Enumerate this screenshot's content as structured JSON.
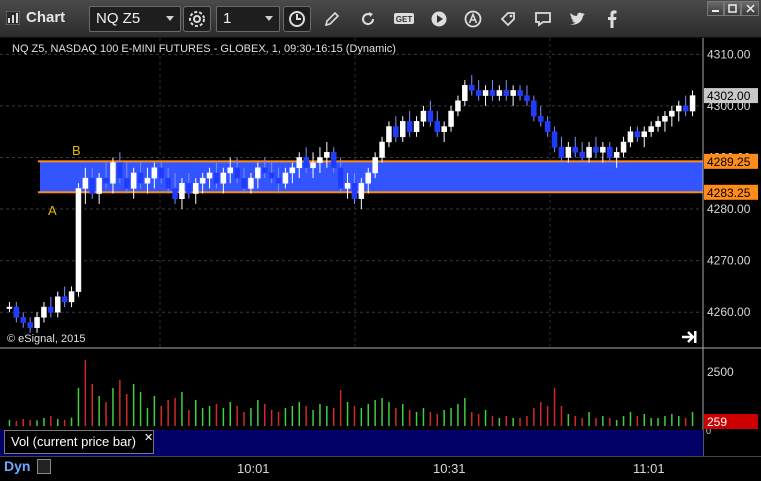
{
  "window": {
    "title": "Chart",
    "symbol": "NQ Z5",
    "interval": "1"
  },
  "toolbar_icons": [
    "settings-gear-icon",
    "clock-icon",
    "pencil-icon",
    "refresh-icon",
    "get-icon",
    "play-icon",
    "alert-a-icon",
    "tag-icon",
    "chat-icon",
    "twitter-icon",
    "facebook-icon"
  ],
  "window_controls": [
    "minimize-icon",
    "maximize-icon",
    "close-icon"
  ],
  "chart": {
    "header": "NQ Z5, NASDAQ 100 E-MINI FUTURES - GLOBEX, 1, 09:30-16:15 (Dynamic)",
    "copyright": "© eSignal, 2015",
    "price_ticks": [
      "4310.00",
      "4300.00",
      "4290.00",
      "4280.00",
      "4270.00",
      "4260.00"
    ],
    "last_price": "4302.00",
    "zone_high": "4289.25",
    "zone_low": "4283.25",
    "label_a": "A",
    "label_b": "B",
    "colors": {
      "up": "#ffffff",
      "down": "#1e3cff",
      "zone": "#3355ff",
      "zone_line": "#ff8c1a",
      "price_tag_bg": "#c8c8c8"
    }
  },
  "volume": {
    "label": "Vol (current price bar)",
    "tick": "2500",
    "zero_tick": "0",
    "current": "259",
    "colors": {
      "up": "#3fcf3f",
      "down": "#cf2a2a",
      "tag_bg": "#cc0000"
    }
  },
  "bottom": {
    "mode": "Dyn",
    "time_labels": [
      "10:01",
      "10:31",
      "11:01"
    ]
  },
  "chart_data": {
    "type": "candlestick",
    "ylim": [
      4255,
      4312
    ],
    "candles": [
      [
        4261,
        4262,
        4260,
        4261
      ],
      [
        4261,
        4262,
        4258,
        4259
      ],
      [
        4259,
        4260,
        4257,
        4258
      ],
      [
        4258,
        4259,
        4256,
        4257
      ],
      [
        4257,
        4260,
        4256,
        4259
      ],
      [
        4259,
        4262,
        4258,
        4261
      ],
      [
        4261,
        4263,
        4259,
        4260
      ],
      [
        4260,
        4264,
        4259,
        4263
      ],
      [
        4263,
        4265,
        4261,
        4262
      ],
      [
        4262,
        4265,
        4261,
        4264
      ],
      [
        4264,
        4285,
        4263,
        4284
      ],
      [
        4284,
        4288,
        4281,
        4286
      ],
      [
        4286,
        4288,
        4282,
        4283
      ],
      [
        4283,
        4287,
        4281,
        4286
      ],
      [
        4286,
        4289,
        4284,
        4285
      ],
      [
        4285,
        4290,
        4283,
        4289
      ],
      [
        4289,
        4291,
        4285,
        4286
      ],
      [
        4286,
        4289,
        4283,
        4284
      ],
      [
        4284,
        4288,
        4282,
        4287
      ],
      [
        4287,
        4289,
        4284,
        4285
      ],
      [
        4285,
        4288,
        4283,
        4286
      ],
      [
        4286,
        4289,
        4284,
        4288
      ],
      [
        4288,
        4289,
        4285,
        4286
      ],
      [
        4286,
        4288,
        4283,
        4284
      ],
      [
        4284,
        4287,
        4281,
        4282
      ],
      [
        4282,
        4286,
        4280,
        4285
      ],
      [
        4285,
        4287,
        4282,
        4283
      ],
      [
        4283,
        4286,
        4281,
        4285
      ],
      [
        4285,
        4287,
        4283,
        4286
      ],
      [
        4286,
        4288,
        4284,
        4287
      ],
      [
        4287,
        4289,
        4284,
        4285
      ],
      [
        4285,
        4288,
        4283,
        4287
      ],
      [
        4287,
        4290,
        4285,
        4288
      ],
      [
        4288,
        4290,
        4285,
        4286
      ],
      [
        4286,
        4288,
        4283,
        4284
      ],
      [
        4284,
        4287,
        4283,
        4286
      ],
      [
        4286,
        4289,
        4284,
        4288
      ],
      [
        4288,
        4290,
        4286,
        4287
      ],
      [
        4287,
        4289,
        4285,
        4286
      ],
      [
        4286,
        4288,
        4283,
        4285
      ],
      [
        4285,
        4288,
        4284,
        4287
      ],
      [
        4287,
        4289,
        4285,
        4288
      ],
      [
        4288,
        4291,
        4286,
        4290
      ],
      [
        4290,
        4292,
        4287,
        4288
      ],
      [
        4288,
        4291,
        4286,
        4289
      ],
      [
        4289,
        4292,
        4287,
        4290
      ],
      [
        4290,
        4293,
        4288,
        4291
      ],
      [
        4291,
        4292,
        4287,
        4288
      ],
      [
        4288,
        4290,
        4283,
        4284
      ],
      [
        4284,
        4287,
        4282,
        4285
      ],
      [
        4285,
        4287,
        4281,
        4282
      ],
      [
        4282,
        4286,
        4280,
        4285
      ],
      [
        4285,
        4288,
        4283,
        4287
      ],
      [
        4287,
        4291,
        4286,
        4290
      ],
      [
        4290,
        4294,
        4289,
        4293
      ],
      [
        4293,
        4297,
        4292,
        4296
      ],
      [
        4296,
        4298,
        4293,
        4294
      ],
      [
        4294,
        4298,
        4293,
        4297
      ],
      [
        4297,
        4299,
        4294,
        4295
      ],
      [
        4295,
        4298,
        4294,
        4297
      ],
      [
        4297,
        4300,
        4296,
        4299
      ],
      [
        4299,
        4301,
        4296,
        4297
      ],
      [
        4297,
        4299,
        4294,
        4295
      ],
      [
        4295,
        4297,
        4293,
        4296
      ],
      [
        4296,
        4300,
        4295,
        4299
      ],
      [
        4299,
        4302,
        4298,
        4301
      ],
      [
        4301,
        4305,
        4300,
        4304
      ],
      [
        4304,
        4306,
        4302,
        4303
      ],
      [
        4303,
        4305,
        4301,
        4302
      ],
      [
        4302,
        4304,
        4300,
        4303
      ],
      [
        4303,
        4305,
        4301,
        4302
      ],
      [
        4302,
        4304,
        4301,
        4303
      ],
      [
        4303,
        4305,
        4301,
        4302
      ],
      [
        4302,
        4304,
        4300,
        4303
      ],
      [
        4303,
        4304,
        4301,
        4302
      ],
      [
        4302,
        4304,
        4300,
        4301
      ],
      [
        4301,
        4302,
        4297,
        4298
      ],
      [
        4298,
        4300,
        4296,
        4297
      ],
      [
        4297,
        4298,
        4294,
        4295
      ],
      [
        4295,
        4296,
        4291,
        4292
      ],
      [
        4292,
        4294,
        4289,
        4290
      ],
      [
        4290,
        4293,
        4289,
        4292
      ],
      [
        4292,
        4294,
        4290,
        4291
      ],
      [
        4291,
        4293,
        4289,
        4290
      ],
      [
        4290,
        4293,
        4289,
        4292
      ],
      [
        4292,
        4294,
        4290,
        4291
      ],
      [
        4291,
        4293,
        4289,
        4292
      ],
      [
        4292,
        4293,
        4289,
        4290
      ],
      [
        4290,
        4292,
        4288,
        4291
      ],
      [
        4291,
        4294,
        4290,
        4293
      ],
      [
        4293,
        4296,
        4292,
        4295
      ],
      [
        4295,
        4296,
        4293,
        4294
      ],
      [
        4294,
        4296,
        4292,
        4295
      ],
      [
        4295,
        4297,
        4294,
        4296
      ],
      [
        4296,
        4298,
        4295,
        4297
      ],
      [
        4297,
        4299,
        4295,
        4298
      ],
      [
        4298,
        4300,
        4296,
        4299
      ],
      [
        4299,
        4301,
        4297,
        4300
      ],
      [
        4300,
        4302,
        4298,
        4299
      ],
      [
        4299,
        4303,
        4298,
        4302
      ]
    ],
    "volume": [
      [
        300,
        1
      ],
      [
        250,
        0
      ],
      [
        350,
        0
      ],
      [
        300,
        0
      ],
      [
        280,
        1
      ],
      [
        400,
        1
      ],
      [
        500,
        0
      ],
      [
        350,
        1
      ],
      [
        300,
        0
      ],
      [
        420,
        1
      ],
      [
        1900,
        1
      ],
      [
        3300,
        0
      ],
      [
        2100,
        0
      ],
      [
        1500,
        1
      ],
      [
        1200,
        0
      ],
      [
        1900,
        1
      ],
      [
        2300,
        0
      ],
      [
        1600,
        0
      ],
      [
        2100,
        1
      ],
      [
        1700,
        1
      ],
      [
        900,
        1
      ],
      [
        1500,
        1
      ],
      [
        1000,
        0
      ],
      [
        1300,
        0
      ],
      [
        1400,
        0
      ],
      [
        1700,
        1
      ],
      [
        800,
        0
      ],
      [
        1300,
        1
      ],
      [
        900,
        1
      ],
      [
        1000,
        1
      ],
      [
        1100,
        0
      ],
      [
        900,
        1
      ],
      [
        1200,
        1
      ],
      [
        1000,
        0
      ],
      [
        700,
        0
      ],
      [
        900,
        1
      ],
      [
        1300,
        1
      ],
      [
        1100,
        0
      ],
      [
        800,
        0
      ],
      [
        700,
        0
      ],
      [
        900,
        1
      ],
      [
        1000,
        1
      ],
      [
        1200,
        1
      ],
      [
        1000,
        0
      ],
      [
        800,
        1
      ],
      [
        1100,
        1
      ],
      [
        1000,
        1
      ],
      [
        900,
        0
      ],
      [
        1800,
        0
      ],
      [
        1200,
        1
      ],
      [
        1000,
        0
      ],
      [
        900,
        1
      ],
      [
        1100,
        1
      ],
      [
        1300,
        1
      ],
      [
        1400,
        1
      ],
      [
        1200,
        1
      ],
      [
        900,
        0
      ],
      [
        1100,
        1
      ],
      [
        800,
        0
      ],
      [
        700,
        1
      ],
      [
        900,
        1
      ],
      [
        700,
        0
      ],
      [
        600,
        0
      ],
      [
        800,
        1
      ],
      [
        900,
        1
      ],
      [
        1100,
        1
      ],
      [
        1400,
        1
      ],
      [
        700,
        0
      ],
      [
        600,
        0
      ],
      [
        800,
        1
      ],
      [
        500,
        0
      ],
      [
        400,
        1
      ],
      [
        500,
        0
      ],
      [
        400,
        1
      ],
      [
        400,
        0
      ],
      [
        500,
        0
      ],
      [
        900,
        0
      ],
      [
        1200,
        0
      ],
      [
        1000,
        0
      ],
      [
        1900,
        0
      ],
      [
        1000,
        0
      ],
      [
        600,
        1
      ],
      [
        500,
        0
      ],
      [
        400,
        0
      ],
      [
        700,
        1
      ],
      [
        400,
        0
      ],
      [
        500,
        1
      ],
      [
        400,
        0
      ],
      [
        300,
        1
      ],
      [
        500,
        1
      ],
      [
        700,
        1
      ],
      [
        500,
        0
      ],
      [
        600,
        1
      ],
      [
        400,
        1
      ],
      [
        400,
        1
      ],
      [
        500,
        1
      ],
      [
        600,
        1
      ],
      [
        500,
        1
      ],
      [
        400,
        0
      ],
      [
        700,
        1
      ]
    ]
  }
}
